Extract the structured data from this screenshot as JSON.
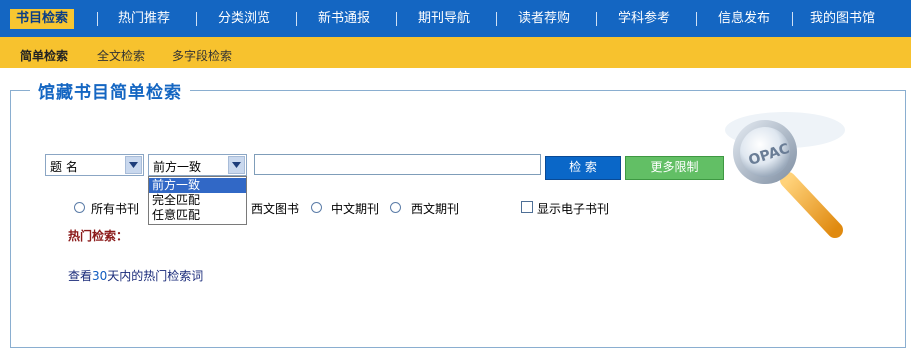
{
  "topnav": {
    "items": [
      "书目检索",
      "热门推荐",
      "分类浏览",
      "新书通报",
      "期刊导航",
      "读者荐购",
      "学科参考",
      "信息发布",
      "我的图书馆"
    ]
  },
  "subnav": {
    "items": [
      "简单检索",
      "全文检索",
      "多字段检索"
    ]
  },
  "panel": {
    "title": "馆藏书目简单检索"
  },
  "search": {
    "field_select": "题 名",
    "match_select": "前方一致",
    "match_options": [
      "前方一致",
      "完全匹配",
      "任意匹配"
    ],
    "input_value": "",
    "search_button": "检 索",
    "more_button": "更多限制"
  },
  "doc_types": {
    "all": "所有书刊",
    "west_book": "西文图书",
    "cn_journal": "中文期刊",
    "west_journal": "西文期刊",
    "ebook_checkbox": "显示电子书刊"
  },
  "hot": {
    "label": "热门检索：",
    "link_prefix": "查看",
    "link_days": "30",
    "link_suffix": "天内的热门检索词"
  },
  "logo": {
    "text": "OPAC"
  },
  "colors": {
    "nav_blue": "#1466c2",
    "nav_yellow": "#f7c22e",
    "search_btn": "#0a67c8",
    "more_btn": "#62bf65",
    "hot_label": "#8b1a1a"
  }
}
